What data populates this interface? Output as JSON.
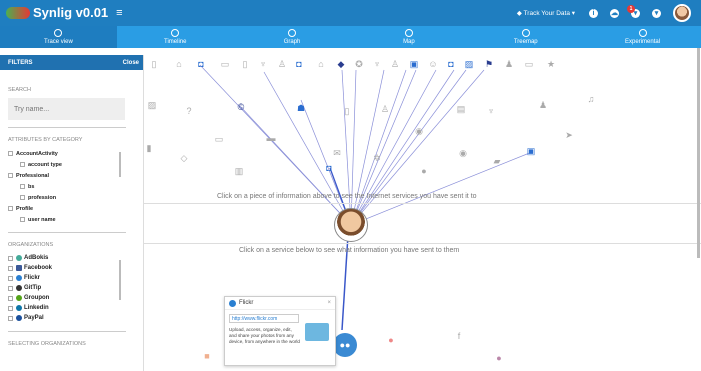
{
  "app": {
    "title": "Synlig v0.01",
    "menu_icon": "hamburger-icon"
  },
  "topbar": {
    "track_label": "◆ Track Your Data ▾",
    "notifications": "1"
  },
  "tabs": [
    {
      "label": "Trace view",
      "icon": "fingerprint-icon",
      "active": true
    },
    {
      "label": "Timeline",
      "icon": "clock-icon"
    },
    {
      "label": "Graph",
      "icon": "bar-chart-icon"
    },
    {
      "label": "Map",
      "icon": "globe-icon"
    },
    {
      "label": "Treemap",
      "icon": "leaf-icon"
    },
    {
      "label": "Experimental",
      "icon": "flask-icon"
    }
  ],
  "sidebar": {
    "title": "FILTERS",
    "close": "Close",
    "search_title": "SEARCH",
    "search_placeholder": "Try name...",
    "attributes_title": "ATTRIBUTES BY CATEGORY",
    "categories": [
      {
        "name": "AccountActivity",
        "subs": [
          "account type"
        ]
      },
      {
        "name": "Professional",
        "subs": [
          "bs",
          "profession"
        ]
      },
      {
        "name": "Profile",
        "subs": [
          "user name"
        ]
      }
    ],
    "organizations_title": "ORGANIZATIONS",
    "organizations": [
      "AdBokis",
      "Facebook",
      "Flickr",
      "GitTip",
      "Groupon",
      "Linkedin",
      "PayPal"
    ],
    "selecting_title": "SELECTING ORGANIZATIONS"
  },
  "canvas": {
    "hint_top": "Click on a piece of information above to see the Internet services you have sent it to",
    "hint_bottom": "Click on a service below to see what information you have sent to them"
  },
  "popup": {
    "title": "Flickr",
    "close": "×",
    "url": "http://www.flickr.com",
    "description": "Upload, access, organize, edit, and share your photos from any device, from anywhere in the world"
  },
  "colors": {
    "topbar": "#1f7ec0",
    "tabs": "#2a9de4",
    "active_tab": "#1e7dc0",
    "accent": "#2a7fd1"
  }
}
